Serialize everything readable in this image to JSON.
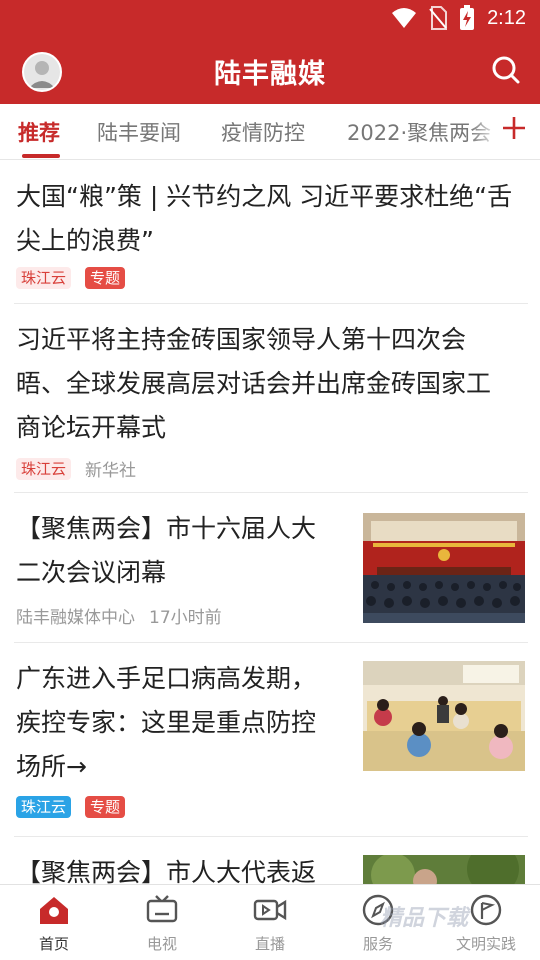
{
  "status_bar": {
    "time": "2:12"
  },
  "header": {
    "title": "陆丰融媒"
  },
  "tabs": [
    {
      "label": "推荐"
    },
    {
      "label": "陆丰要闻"
    },
    {
      "label": "疫情防控"
    },
    {
      "label": "2022·聚焦两会"
    }
  ],
  "feed": [
    {
      "title_line1": "大国“粮”策 | 兴节约之风 习近平要求杜绝“舌",
      "title_line2": "尖上的浪费”",
      "source": "珠江云",
      "tag": "专题"
    },
    {
      "title_line1": "习近平将主持金砖国家领导人第十四次会",
      "title_line2": "晤、全球发展高层对话会并出席金砖国家工",
      "title_line3": "商论坛开幕式",
      "source": "珠江云",
      "publisher": "新华社"
    },
    {
      "title_line1": "【聚焦两会】市十六届人大",
      "title_line2": "二次会议闭幕",
      "publisher": "陆丰融媒体中心",
      "time": "17小时前"
    },
    {
      "title_line1": "广东进入手足口病高发期，",
      "title_line2": "疾控专家：这里是重点防控",
      "title_line3": "场所→",
      "source": "珠江云",
      "tag": "专题"
    },
    {
      "title_line1": "【聚焦两会】市人大代表返"
    }
  ],
  "bottom_nav": [
    {
      "label": "首页",
      "icon": "home-icon"
    },
    {
      "label": "电视",
      "icon": "tv-icon"
    },
    {
      "label": "直播",
      "icon": "live-video-icon"
    },
    {
      "label": "服务",
      "icon": "compass-icon"
    },
    {
      "label": "文明实践",
      "icon": "flag-icon"
    }
  ],
  "watermark": "精品下载",
  "colors": {
    "brand": "#c72a2a",
    "topic_tag": "#e54d45",
    "source_blue": "#2aa3e6"
  }
}
